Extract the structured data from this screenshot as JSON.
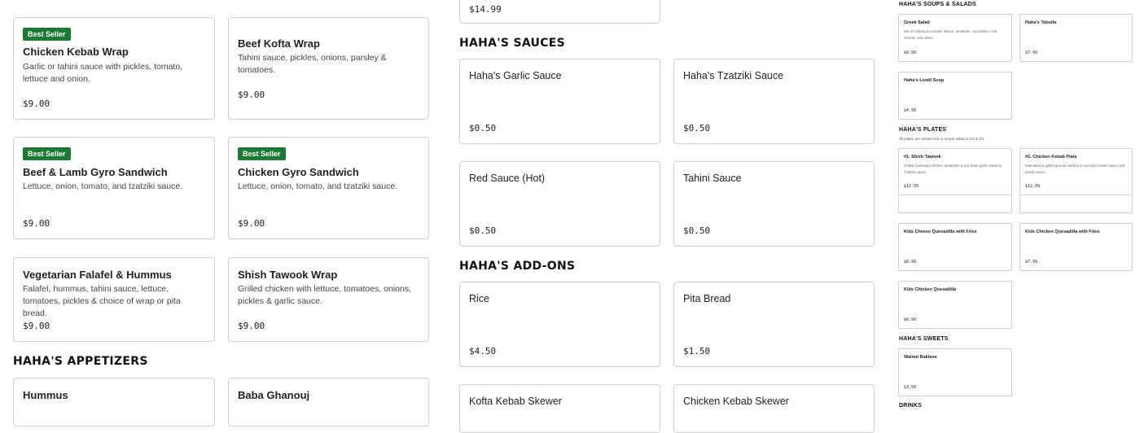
{
  "left_menu": {
    "cards": [
      {
        "badge": "Best Seller",
        "title": "Chicken Kebab Wrap",
        "desc": "Garlic or tahini sauce with pickles, tomato, lettuce and onion.",
        "price": "$9.00"
      },
      {
        "badge": "",
        "title": "Beef Kofta Wrap",
        "desc": "Tahini sauce, pickles, onions, parsley & tomatoes.",
        "price": "$9.00"
      },
      {
        "badge": "Best Seller",
        "title": "Beef & Lamb Gyro Sandwich",
        "desc": "Lettuce, onion, tomato, and tzatziki sauce.",
        "price": "$9.00"
      },
      {
        "badge": "Best Seller",
        "title": "Chicken Gyro Sandwich",
        "desc": "Lettuce, onion, tomato, and tzatziki sauce.",
        "price": "$9.00"
      },
      {
        "badge": "",
        "title": "Vegetarian Falafel & Hummus",
        "desc": "Falafel, hummus, tahini sauce, lettuce, tomatoes, pickles & choice of wrap or pita bread.",
        "price": "$9.00"
      },
      {
        "badge": "",
        "title": "Shish Tawook Wrap",
        "desc": "Grilled chicken with lettuce, tomatoes, onions, pickles & garlic sauce.",
        "price": "$9.00"
      }
    ],
    "appetizers_heading": "HAHA'S APPETIZERS",
    "appetizers": [
      {
        "title": "Hummus"
      },
      {
        "title": "Baba Ghanouj"
      }
    ]
  },
  "middle_menu": {
    "top_price": "$14.99",
    "sauces_heading": "HAHA'S SAUCES",
    "sauces": [
      {
        "title": "Haha's Garlic Sauce",
        "price": "$0.50"
      },
      {
        "title": "Haha's Tzatziki Sauce",
        "price": "$0.50"
      },
      {
        "title": "Red Sauce (Hot)",
        "price": "$0.50"
      },
      {
        "title": "Tahini Sauce",
        "price": "$0.50"
      }
    ],
    "addons_heading": "HAHA'S ADD-ONS",
    "addons": [
      {
        "title": "Rice",
        "price": "$4.50"
      },
      {
        "title": "Pita Bread",
        "price": "$1.50"
      },
      {
        "title": "Kofta Kebab Skewer",
        "price": ""
      },
      {
        "title": "Chicken Kebab Skewer",
        "price": ""
      }
    ]
  },
  "right_menu": {
    "soups_heading": "HAHA'S SOUPS & SALADS",
    "soups": [
      {
        "title": "Greek Salad",
        "desc": "Mix of iceberg & romaine lettuce, tomatoes, cucumbers, feta cheese, and olives.",
        "price": "$6.99"
      },
      {
        "title": "Haha's Tabulla",
        "desc": "",
        "price": "$7.99"
      },
      {
        "title": "Haha's Lentil Soup",
        "desc": "",
        "price": "$4.99"
      }
    ],
    "plates_heading": "HAHA'S PLATES",
    "plates_sub": "All plates are served rice or Greek salad or 1/2 & 1/2.",
    "plates": [
      {
        "title": "#1. Shish Tawook",
        "desc": "Grilled marinated chicken tenderloin & our Toum garlic sauce & Tzatziki sauce.",
        "price": "$12.99"
      },
      {
        "title": "#2. Chicken Kebab Plate",
        "desc": "Marinated & grilled ground chicken in our toum Garlic sauce and tzaziki sauce.",
        "price": "$12.99"
      }
    ],
    "kids": [
      {
        "title": "Kids Cheese Quesadilla with Fries",
        "price": "$6.99"
      },
      {
        "title": "Kids Chicken Quesadilla with Fries",
        "price": "$7.99"
      },
      {
        "title": "Kids Chicken Quesadilla",
        "price": "$6.99"
      }
    ],
    "sweets_heading": "HAHA'S SWEETS",
    "sweets": [
      {
        "title": "Walnut Baklava",
        "price": "$3.50"
      }
    ],
    "drinks_heading": "DRINKS"
  }
}
